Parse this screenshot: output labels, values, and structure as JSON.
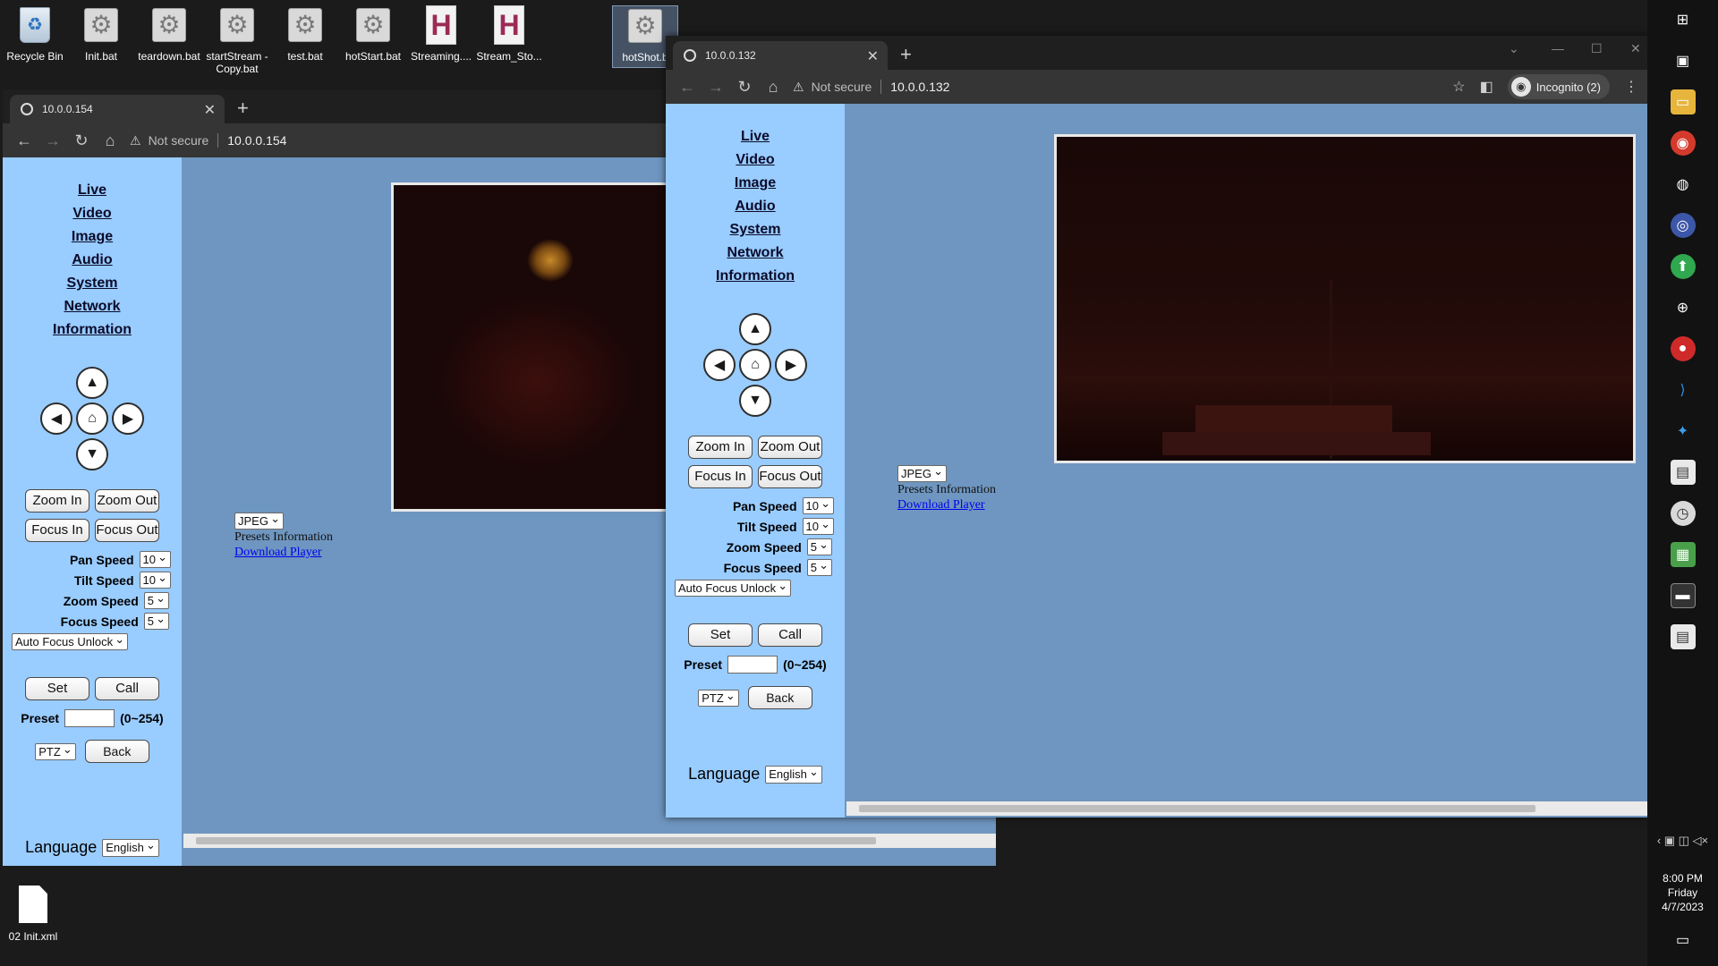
{
  "desktop": {
    "icons": [
      {
        "label": "Recycle Bin",
        "glyph": "♻"
      },
      {
        "label": "Init.bat",
        "glyph": "⚙"
      },
      {
        "label": "teardown.bat",
        "glyph": "⚙"
      },
      {
        "label": "startStream - Copy.bat",
        "glyph": "⚙"
      },
      {
        "label": "test.bat",
        "glyph": "⚙"
      },
      {
        "label": "hotStart.bat",
        "glyph": "⚙"
      },
      {
        "label": "Streaming....",
        "glyph": "H"
      },
      {
        "label": "Stream_Sto...",
        "glyph": "H"
      },
      {
        "label": "hotShot.b",
        "glyph": "⚙"
      }
    ],
    "bottom_icon": {
      "label": "02 Init.xml"
    }
  },
  "window1": {
    "tab_title": "10.0.0.154",
    "not_secure": "Not secure",
    "url": "10.0.0.154"
  },
  "window2": {
    "tab_title": "10.0.0.132",
    "not_secure": "Not secure",
    "url": "10.0.0.132",
    "incognito": "Incognito (2)"
  },
  "camera_ui": {
    "menu": [
      "Live",
      "Video",
      "Image",
      "Audio",
      "System",
      "Network",
      "Information"
    ],
    "ptz_glyphs": {
      "up": "▲",
      "left": "◀",
      "home": "⌂",
      "right": "▶",
      "down": "▼"
    },
    "zoom_in": "Zoom In",
    "zoom_out": "Zoom Out",
    "focus_in": "Focus In",
    "focus_out": "Focus Out",
    "pan_speed_label": "Pan Speed",
    "pan_speed": "10",
    "tilt_speed_label": "Tilt Speed",
    "tilt_speed": "10",
    "zoom_speed_label": "Zoom Speed",
    "zoom_speed": "5",
    "focus_speed_label": "Focus Speed",
    "focus_speed": "5",
    "auto_focus": "Auto Focus Unlock",
    "set": "Set",
    "call": "Call",
    "preset_label": "Preset",
    "preset_range": "(0~254)",
    "mode": "PTZ",
    "back": "Back",
    "language_label": "Language",
    "language": "English",
    "stream_format": "JPEG",
    "presets_info": "Presets Information",
    "download_player": "Download Player"
  },
  "taskbar": {
    "time": "8:00 PM",
    "day": "Friday",
    "date": "4/7/2023"
  },
  "colors": {
    "sidebar": "#99ccff",
    "content_bg": "#6f96c0",
    "link": "#0000ee"
  }
}
